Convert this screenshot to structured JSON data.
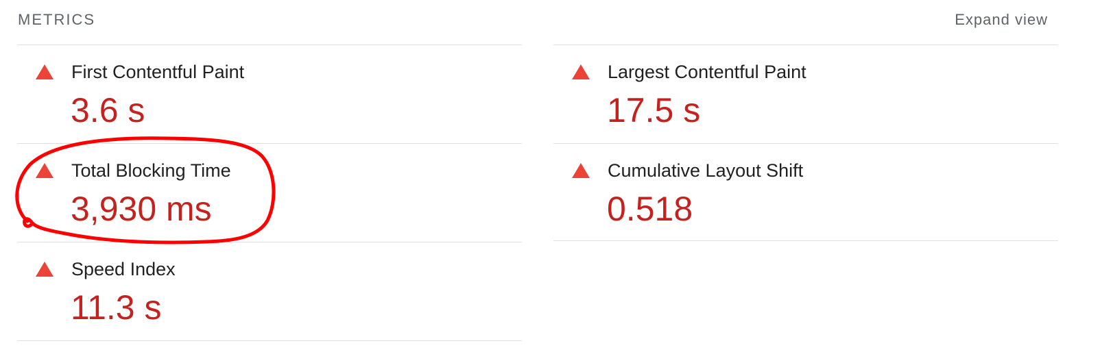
{
  "header": {
    "title": "METRICS",
    "expand_label": "Expand view"
  },
  "metrics": {
    "fcp": {
      "label": "First Contentful Paint",
      "value": "3.6 s"
    },
    "lcp": {
      "label": "Largest Contentful Paint",
      "value": "17.5 s"
    },
    "tbt": {
      "label": "Total Blocking Time",
      "value": "3,930 ms"
    },
    "cls": {
      "label": "Cumulative Layout Shift",
      "value": "0.518"
    },
    "si": {
      "label": "Speed Index",
      "value": "11.3 s"
    }
  },
  "colors": {
    "warning_icon": "#eb4335",
    "value_text": "#c5221f",
    "annotation_circle": "#ff0000"
  },
  "icons": {
    "status": "warning-triangle-icon"
  }
}
